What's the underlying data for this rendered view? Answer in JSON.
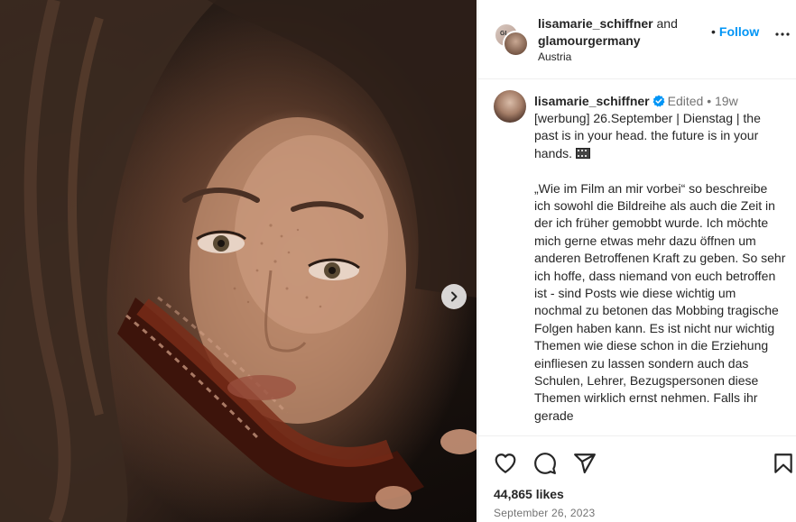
{
  "post": {
    "header": {
      "author": "lisamarie_schiffner",
      "and_text": "and",
      "collaborator": "glamourgermany",
      "location": "Austria",
      "follow_dot": "•",
      "follow_label": "Follow",
      "avatar_badge_text": "GL"
    },
    "caption": {
      "username": "lisamarie_schiffner",
      "edited": "Edited",
      "dot": "•",
      "age": "19w",
      "line1": "[werbung] 26.September | Dienstag | the past is in your head. the future is in your hands.",
      "line2": "„Wie im Film an mir vorbei“ so beschreibe ich sowohl die Bildreihe als auch die Zeit in der ich früher gemobbt wurde. Ich möchte mich gerne etwas mehr dazu öffnen um anderen Betroffenen Kraft zu geben. So sehr ich hoffe, dass niemand von euch betroffen ist - sind Posts wie diese wichtig um nochmal zu betonen das Mobbing tragische Folgen haben kann. Es ist nicht nur wichtig Themen wie diese schon in die Erziehung einfliesen zu lassen sondern auch das Schulen, Lehrer, Bezugspersonen diese Themen wirklich ernst nehmen. Falls ihr gerade"
    },
    "stats": {
      "likes": "44,865 likes",
      "date": "September 26, 2023"
    },
    "icons": {
      "next": "chevron-right-icon",
      "more": "more-horizontal-icon",
      "like": "heart-icon",
      "comment": "comment-icon",
      "share": "share-icon",
      "save": "bookmark-icon",
      "verified": "verified-badge-icon",
      "emoji": "film-frames-emoji"
    },
    "colors": {
      "accent": "#0095f6",
      "muted": "#737373",
      "text": "#262626"
    }
  }
}
